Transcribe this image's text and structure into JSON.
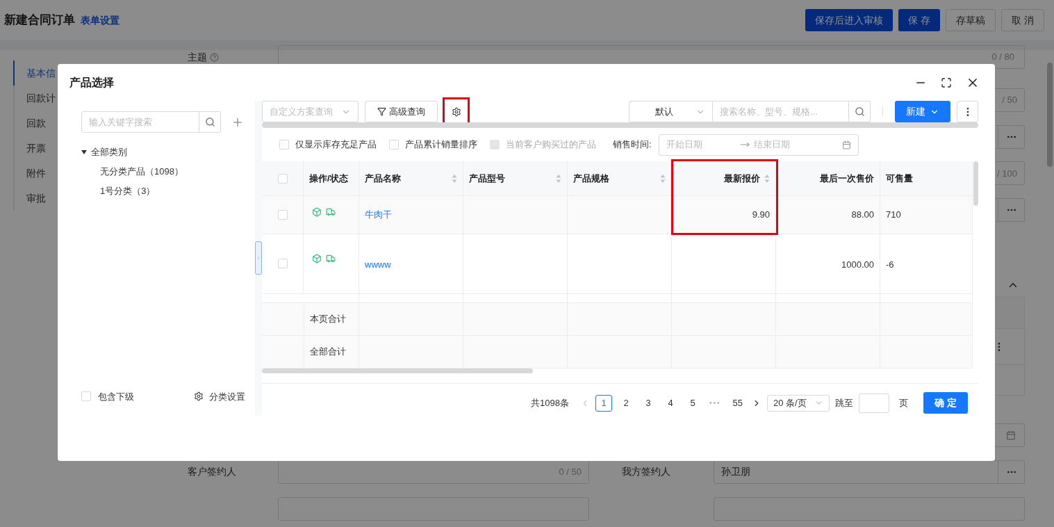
{
  "page": {
    "title": "新建合同订单",
    "settings_link": "表单设置",
    "buttons": [
      {
        "label": "保存后进入审核",
        "kind": "primary"
      },
      {
        "label": "保 存",
        "kind": "primary"
      },
      {
        "label": "存草稿",
        "kind": "default"
      },
      {
        "label": "取 消",
        "kind": "default"
      }
    ]
  },
  "nav": [
    {
      "label": "基本信",
      "selected": true
    },
    {
      "label": "回款计",
      "selected": false
    },
    {
      "label": "回款",
      "selected": false
    },
    {
      "label": "开票",
      "selected": false
    },
    {
      "label": "附件",
      "selected": false
    },
    {
      "label": "审批",
      "selected": false
    }
  ],
  "form": {
    "subject_label": "主题",
    "subject_counter": "0 / 80",
    "rows": [
      {
        "kind": "counter",
        "counter": "/ 50"
      },
      {
        "kind": "picker"
      },
      {
        "kind": "counter",
        "counter": "/ 100"
      },
      {
        "kind": "picker"
      }
    ],
    "customer_signer_label": "客户签约人",
    "customer_signer_counter": "0 / 50",
    "our_signer_label": "我方签约人",
    "our_signer_value": "孙卫朋"
  },
  "dialog": {
    "title": "产品选择",
    "category_search": {
      "placeholder": "输入关键字搜索"
    },
    "tree": [
      {
        "label": "全部类别",
        "expanded": true,
        "children": [
          {
            "label": "无分类产品（1098）"
          },
          {
            "label": "1号分类（3）"
          }
        ]
      }
    ],
    "include_children": {
      "label": "包含下级",
      "checked": false
    },
    "category_settings": "分类设置",
    "toolbar": {
      "scheme": {
        "placeholder": "自定义方案查询"
      },
      "advanced": "高级查询",
      "settings_highlighted": true,
      "sort_select": "默认",
      "search": {
        "placeholder": "搜索名称、型号、规格..."
      },
      "new_button": "新建"
    },
    "filters": [
      {
        "label": "仅显示库存充足产品",
        "checked": false,
        "disabled": false
      },
      {
        "label": "产品累计销量排序",
        "checked": false,
        "disabled": false
      },
      {
        "label": "当前客户购买过的产品",
        "checked": false,
        "disabled": true
      }
    ],
    "sale_time": {
      "label": "销售时间:",
      "start": {
        "placeholder": "开始日期"
      },
      "end": {
        "placeholder": "结束日期"
      }
    },
    "table": {
      "all_checked": false,
      "columns": [
        {
          "label": "操作/状态",
          "kind": "text",
          "sortable": false,
          "highlighted": false
        },
        {
          "label": "产品名称",
          "kind": "text",
          "sortable": true,
          "highlighted": false
        },
        {
          "label": "产品型号",
          "kind": "text",
          "sortable": true,
          "highlighted": false
        },
        {
          "label": "产品规格",
          "kind": "text",
          "sortable": true,
          "highlighted": false
        },
        {
          "label": "最新报价",
          "kind": "amount",
          "sortable": true,
          "highlighted": true
        },
        {
          "label": "最后一次售价",
          "kind": "amount",
          "sortable": false,
          "highlighted": false
        },
        {
          "label": "可售量",
          "kind": "text",
          "sortable": false,
          "highlighted": false
        }
      ],
      "rows": [
        {
          "checked": false,
          "cells": [
            "",
            "牛肉干",
            "",
            "",
            "9.90",
            "88.00",
            "710"
          ]
        },
        {
          "checked": false,
          "cells": [
            "",
            "wwww",
            "",
            "",
            "",
            "1000.00",
            "-6"
          ]
        }
      ],
      "summary_rows": [
        "本页合计",
        "全部合计"
      ]
    },
    "pagination": {
      "total": "共1098条",
      "pages": [
        {
          "label": "1",
          "selected": true,
          "kind": "page"
        },
        {
          "label": "2",
          "selected": false,
          "kind": "page"
        },
        {
          "label": "3",
          "selected": false,
          "kind": "page"
        },
        {
          "label": "4",
          "selected": false,
          "kind": "page"
        },
        {
          "label": "5",
          "selected": false,
          "kind": "page"
        },
        {
          "label": "•••",
          "kind": "ellipsis"
        },
        {
          "label": "55",
          "selected": false,
          "kind": "page"
        }
      ],
      "page_size": "20 条/页",
      "jump_label": "跳至",
      "page_unit": "页",
      "confirm": "确 定"
    }
  }
}
